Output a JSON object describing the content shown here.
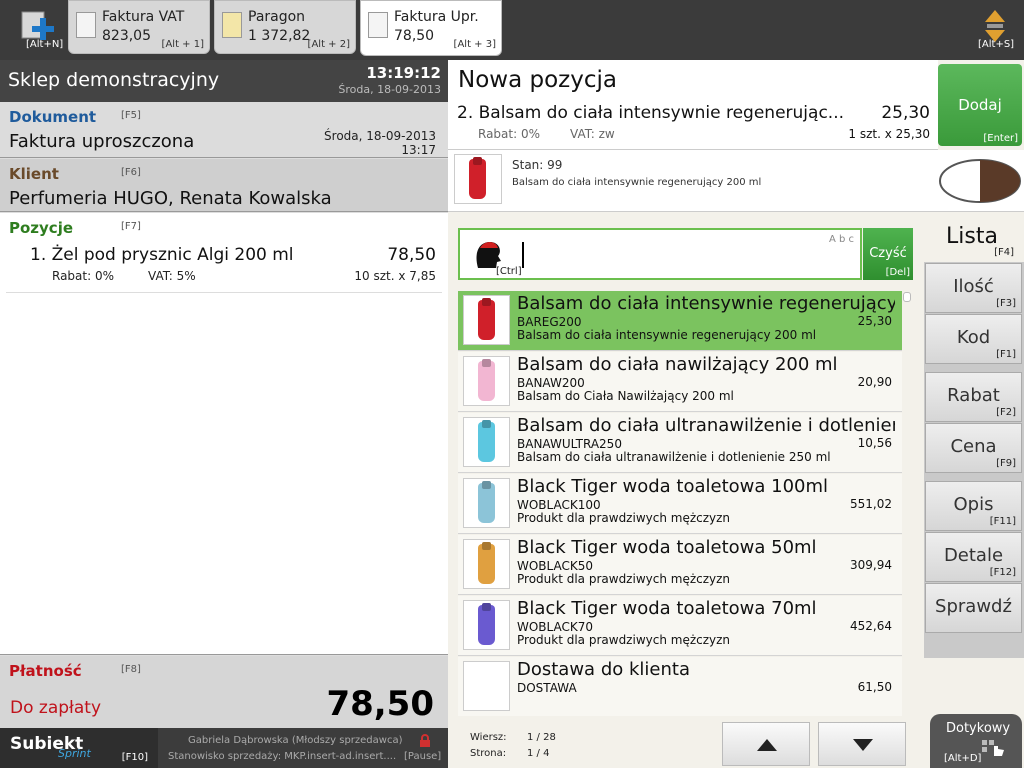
{
  "topbar": {
    "new_key": "[Alt+N]",
    "switch_key": "[Alt+S]",
    "tabs": [
      {
        "name": "Faktura VAT",
        "amount": "823,05",
        "key": "[Alt + 1]"
      },
      {
        "name": "Paragon",
        "amount": "1 372,82",
        "key": "[Alt + 2]"
      },
      {
        "name": "Faktura Upr.",
        "amount": "78,50",
        "key": "[Alt + 3]"
      }
    ]
  },
  "left": {
    "store": "Sklep demonstracyjny",
    "time": "13:19:12",
    "date": "Środa, 18-09-2013",
    "dokument": {
      "title": "Dokument",
      "key": "[F5]",
      "value": "Faktura uproszczona",
      "date": "Środa, 18-09-2013",
      "time": "13:17"
    },
    "klient": {
      "title": "Klient",
      "key": "[F6]",
      "value": "Perfumeria HUGO, Renata Kowalska"
    },
    "pozycje": {
      "title": "Pozycje",
      "key": "[F7]",
      "item_name": "1. Żel pod prysznic Algi 200 ml",
      "item_price": "78,50",
      "rabat": "Rabat: 0%",
      "vat": "VAT: 5%",
      "qty": "10 szt. x 7,85"
    },
    "platnosc": {
      "title": "Płatność",
      "key": "[F8]",
      "label": "Do zapłaty",
      "amount": "78,50"
    },
    "footer": {
      "brand": "Subiekt",
      "brand_sub": "Sprint",
      "key": "[F10]",
      "user": "Gabriela Dąbrowska (Młodszy sprzedawca)",
      "station": "Stanowisko sprzedaży: MKP.insert-ad.insert....",
      "pause_key": "[Pause]"
    }
  },
  "nowa": {
    "title": "Nowa pozycja",
    "item_name": "2. Balsam do ciała intensywnie regenerując...",
    "price": "25,30",
    "rabat": "Rabat: 0%",
    "vat": "VAT: zw",
    "qty": "1 szt. x 25,30",
    "add_label": "Dodaj",
    "add_key": "[Enter]",
    "stan": "Stan: 99",
    "desc": "Balsam do ciała intensywnie regenerujący 200 ml"
  },
  "search": {
    "value": "",
    "key": "[Ctrl]",
    "clear_label": "Czyść",
    "clear_key": "[Del]",
    "abc": "A b c"
  },
  "side": {
    "lista": "Lista",
    "lista_key": "[F4]",
    "buttons": [
      {
        "label": "Ilość",
        "key": "[F3]"
      },
      {
        "label": "Kod",
        "key": "[F1]"
      },
      {
        "label": "Rabat",
        "key": "[F2]"
      },
      {
        "label": "Cena",
        "key": "[F9]"
      },
      {
        "label": "Opis",
        "key": "[F11]"
      },
      {
        "label": "Detale",
        "key": "[F12]"
      },
      {
        "label": "Sprawdź",
        "key": ""
      }
    ],
    "dotykowy": "Dotykowy",
    "dotykowy_key": "[Alt+D]"
  },
  "products": [
    {
      "name": "Balsam do ciała intensywnie regenerujący...",
      "code": "BAREG200",
      "price": "25,30",
      "desc": "Balsam do ciała intensywnie regenerujący 200 ml",
      "color": "#d0202a"
    },
    {
      "name": "Balsam do ciała nawilżający 200 ml",
      "code": "BANAW200",
      "price": "20,90",
      "desc": "Balsam do Ciała Nawilżający 200 ml",
      "color": "#f2b6d2"
    },
    {
      "name": "Balsam do ciała ultranawilżenie i dotlenien...",
      "code": "BANAWULTRA250",
      "price": "10,56",
      "desc": "Balsam do ciała ultranawilżenie i dotlenienie 250 ml",
      "color": "#5cc7e0"
    },
    {
      "name": "Black Tiger woda toaletowa 100ml",
      "code": "WOBLACK100",
      "price": "551,02",
      "desc": "Produkt dla prawdziwych mężczyzn",
      "color": "#8cc4d8"
    },
    {
      "name": "Black Tiger woda toaletowa 50ml",
      "code": "WOBLACK50",
      "price": "309,94",
      "desc": "Produkt dla prawdziwych mężczyzn",
      "color": "#e0a040"
    },
    {
      "name": "Black Tiger woda toaletowa 70ml",
      "code": "WOBLACK70",
      "price": "452,64",
      "desc": "Produkt dla prawdziwych mężczyzn",
      "color": "#6a5ad0"
    },
    {
      "name": "Dostawa do klienta",
      "code": "DOSTAWA",
      "price": "61,50",
      "desc": "",
      "color": ""
    }
  ],
  "pager": {
    "wiersz_label": "Wiersz:",
    "wiersz": "1 / 28",
    "strona_label": "Strona:",
    "strona": "1 / 4"
  }
}
